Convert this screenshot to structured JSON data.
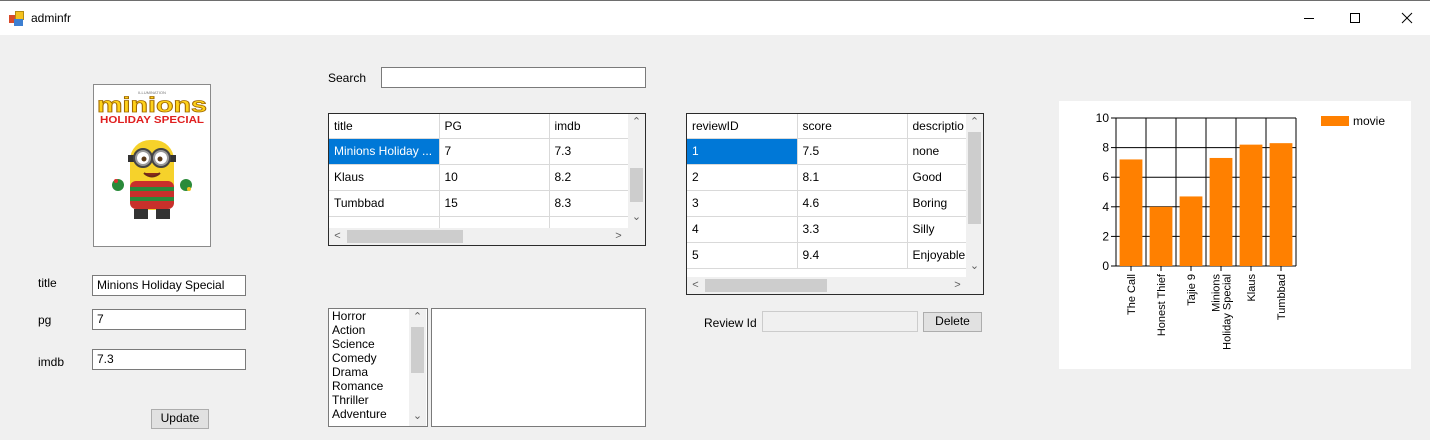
{
  "window": {
    "title": "adminfr",
    "icon": "app-form-icon"
  },
  "controls": {
    "minimize": "minimize-icon",
    "maximize": "maximize-icon",
    "close": "close-icon"
  },
  "poster": {
    "brand": "minions",
    "subtitle": "HOLIDAY SPECIAL",
    "icon": "movie-poster"
  },
  "form": {
    "title_label": "title",
    "title_value": "Minions Holiday Special",
    "pg_label": "pg",
    "pg_value": "7",
    "imdb_label": "imdb",
    "imdb_value": "7.3",
    "update_label": "Update"
  },
  "search": {
    "label": "Search",
    "value": ""
  },
  "movies_grid": {
    "columns": [
      "title",
      "PG",
      "imdb"
    ],
    "rows": [
      [
        "Minions Holiday ...",
        "7",
        "7.3"
      ],
      [
        "Klaus",
        "10",
        "8.2"
      ],
      [
        "Tumbbad",
        "15",
        "8.3"
      ]
    ]
  },
  "reviews_grid": {
    "columns": [
      "reviewID",
      "score",
      "descriptio"
    ],
    "rows": [
      [
        "1",
        "7.5",
        "none"
      ],
      [
        "2",
        "8.1",
        "Good"
      ],
      [
        "3",
        "4.6",
        "Boring"
      ],
      [
        "4",
        "3.3",
        "Silly"
      ],
      [
        "5",
        "9.4",
        "Enjoyable"
      ]
    ]
  },
  "genres": [
    "Horror",
    "Action",
    "Science",
    "Comedy",
    "Drama",
    "Romance",
    "Thriller",
    "Adventure"
  ],
  "review_delete": {
    "label": "Review Id",
    "value": "",
    "button": "Delete"
  },
  "chart_data": {
    "type": "bar",
    "categories": [
      "The Call",
      "Honest Thief",
      "Tajie 9",
      "Minions Holiday Special",
      "Klaus",
      "Tumbbad"
    ],
    "category_lines": [
      [
        "The Call"
      ],
      [
        "Honest Thief"
      ],
      [
        "Tajie 9"
      ],
      [
        "Minions",
        "Holiday Special"
      ],
      [
        "Klaus"
      ],
      [
        "Tumbbad"
      ]
    ],
    "series": [
      {
        "name": "movie",
        "values": [
          7.2,
          4.0,
          4.7,
          7.3,
          8.2,
          8.3
        ]
      }
    ],
    "yticks": [
      "0",
      "2",
      "4",
      "6",
      "8",
      "10"
    ],
    "ylim": [
      0,
      10
    ],
    "grid": true,
    "legend": "top-right",
    "color": "#ff8000"
  }
}
